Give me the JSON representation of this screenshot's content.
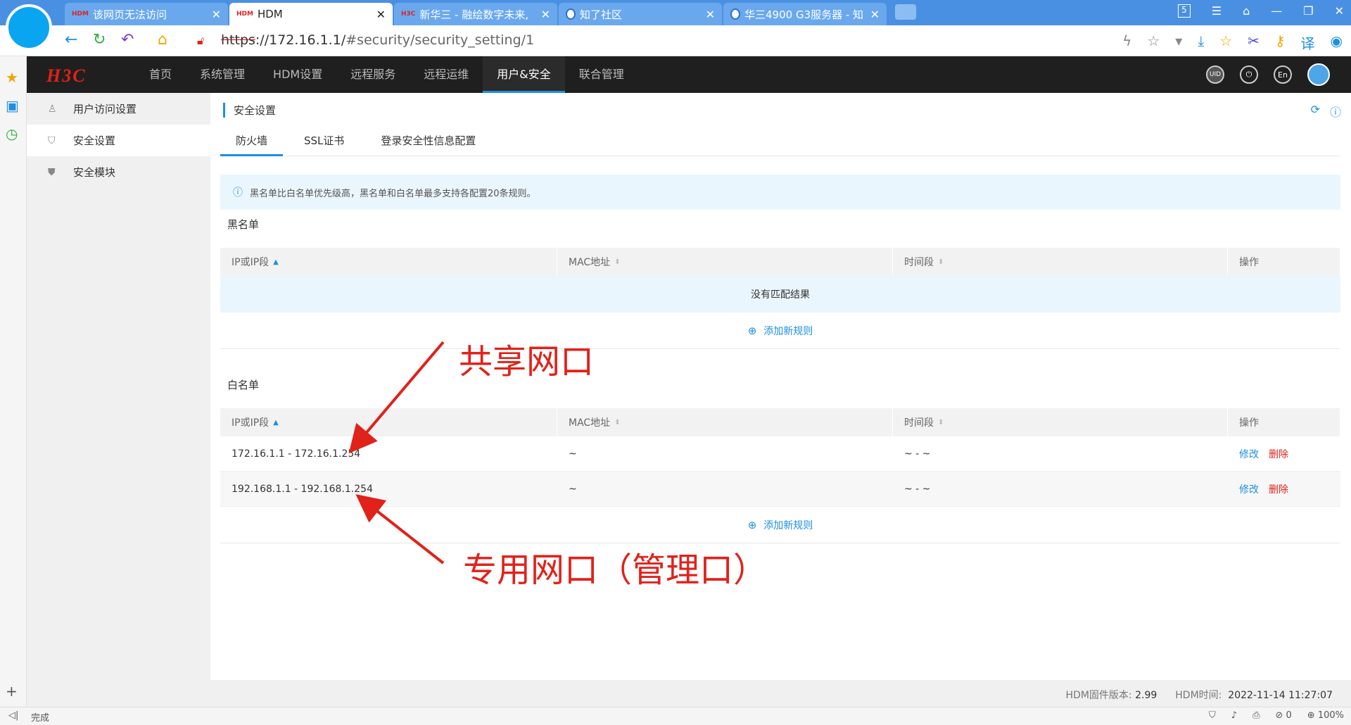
{
  "browser": {
    "tabs": [
      {
        "favicon": "HDM",
        "title": "该网页无法访问"
      },
      {
        "favicon": "HDM",
        "title": "HDM"
      },
      {
        "favicon": "H3C",
        "title": "新华三 - 融绘数字未来,"
      },
      {
        "favicon": "",
        "title": "知了社区"
      },
      {
        "favicon": "",
        "title": "华三4900 G3服务器 - 知"
      }
    ],
    "window_badge": "5",
    "url_protocol": "https",
    "url_host": "://172.16.1.1/",
    "url_path": "#security/security_setting/1",
    "status_text": "完成",
    "status_right": {
      "count": "0",
      "zoom": "100%"
    }
  },
  "app": {
    "logo": "H3C",
    "nav": [
      "首页",
      "系统管理",
      "HDM设置",
      "远程服务",
      "远程运维",
      "用户&安全",
      "联合管理"
    ],
    "header_icons": {
      "uid": "UID",
      "lang": "En"
    },
    "menu": [
      "用户访问设置",
      "安全设置",
      "安全模块"
    ],
    "breadcrumb": "安全设置",
    "tabs": [
      "防火墙",
      "SSL证书",
      "登录安全性信息配置"
    ],
    "notice": "黑名单比白名单优先级高，黑名单和白名单最多支持各配置20条规则。",
    "columns": [
      "IP或IP段",
      "MAC地址",
      "时间段",
      "操作"
    ],
    "blacklist": {
      "title": "黑名单",
      "empty_text": "没有匹配结果",
      "add_label": "添加新规则"
    },
    "whitelist": {
      "title": "白名单",
      "rows": [
        {
          "ip": "172.16.1.1 - 172.16.1.254",
          "mac": "~",
          "time": "~ - ~",
          "edit": "修改",
          "delete": "删除"
        },
        {
          "ip": "192.168.1.1 - 192.168.1.254",
          "mac": "~",
          "time": "~ - ~",
          "edit": "修改",
          "delete": "删除"
        }
      ],
      "add_label": "添加新规则"
    },
    "footer": {
      "fw_label": "HDM固件版本:",
      "fw_value": "2.99",
      "time_label": "HDM时间:",
      "time_value": "2022-11-14 11:27:07"
    }
  },
  "annotations": {
    "shared": "共享网口",
    "dedicated": "专用网口（管理口）"
  },
  "colors": {
    "accent": "#1d8fe1",
    "brand_red": "#e0221a",
    "header_bg": "#1f1f1f"
  }
}
